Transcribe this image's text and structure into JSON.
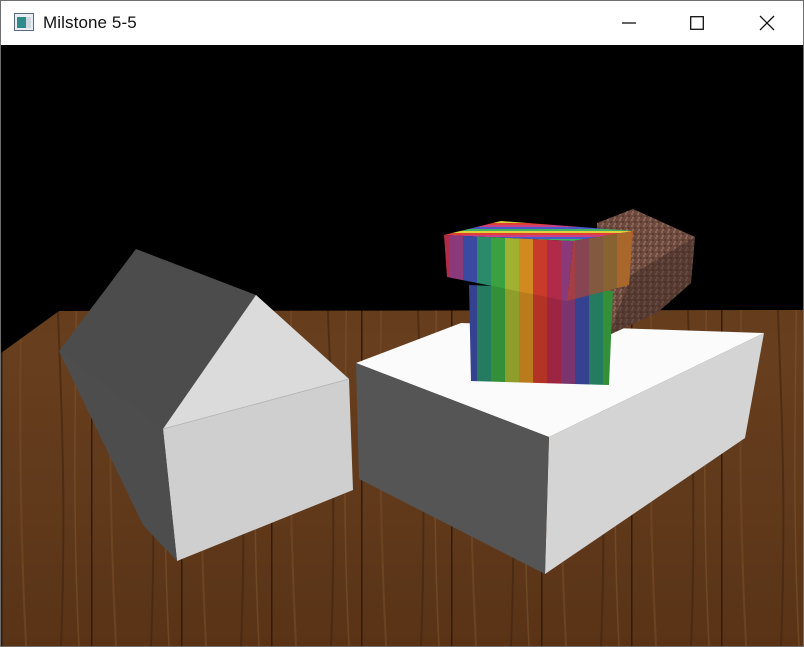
{
  "window": {
    "title": "Milstone 5-5",
    "controls": {
      "minimize": "minimize-icon",
      "maximize": "maximize-icon",
      "close": "close-icon"
    }
  },
  "scene": {
    "background_color": "#000000",
    "objects": [
      "wood-table",
      "house",
      "white-box",
      "rainbow-cube-bottom",
      "rainbow-cube-top",
      "granite-pyramid"
    ],
    "colors": {
      "wood": "#6b3f1e",
      "house_dark": "#4a4a4a",
      "house_light": "#c8c8c8",
      "box_top": "#ffffff",
      "box_front": "#d6d6d6",
      "box_side": "#555555",
      "stone": "#6e4a3e"
    }
  }
}
